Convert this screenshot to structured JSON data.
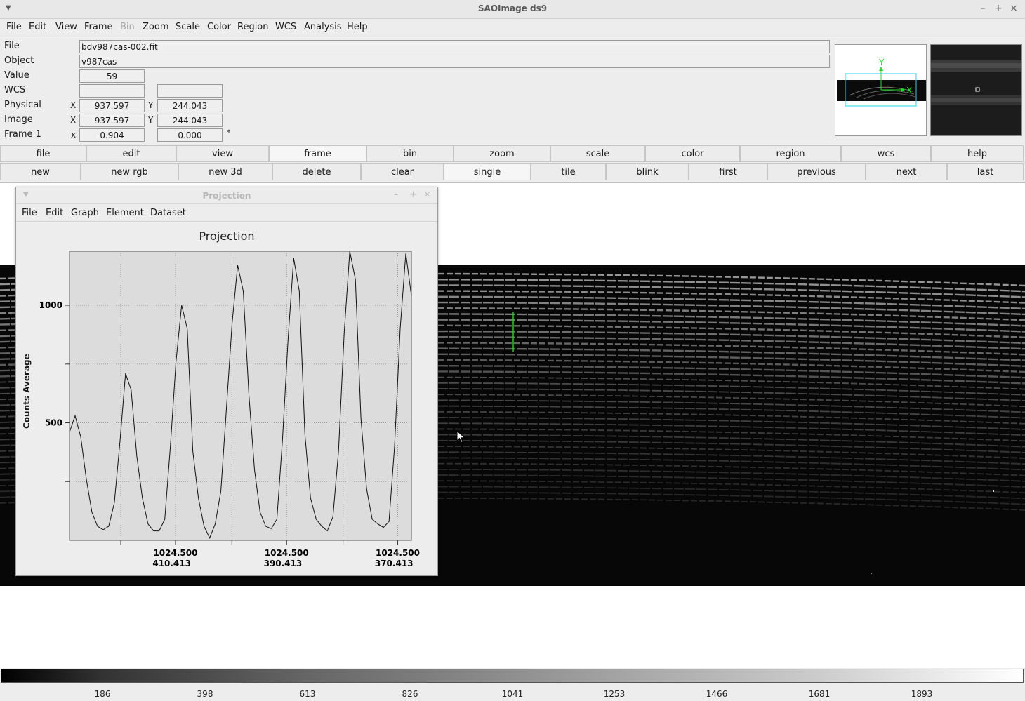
{
  "window": {
    "title": "SAOImage ds9"
  },
  "menubar": [
    "File",
    "Edit",
    "View",
    "Frame",
    "Bin",
    "Zoom",
    "Scale",
    "Color",
    "Region",
    "WCS",
    "Analysis",
    "Help"
  ],
  "menubar_disabled": [
    "Bin"
  ],
  "info": {
    "file_label": "File",
    "file_value": "bdv987cas-002.fit",
    "object_label": "Object",
    "object_value": "v987cas",
    "value_label": "Value",
    "value_value": "59",
    "wcs_label": "WCS",
    "wcs_value1": "",
    "wcs_value2": "",
    "physical_label": "Physical",
    "physical_x_axis": "X",
    "physical_x": "937.597",
    "physical_y_axis": "Y",
    "physical_y": "244.043",
    "image_label": "Image",
    "image_x_axis": "X",
    "image_x": "937.597",
    "image_y_axis": "Y",
    "image_y": "244.043",
    "frame_label": "Frame 1",
    "frame_x_axis": "x",
    "frame_zoom": "0.904",
    "frame_angle": "0.000",
    "frame_angle_unit": "°"
  },
  "panner": {
    "x_label": "X",
    "y_label": "Y"
  },
  "button_row1": [
    "file",
    "edit",
    "view",
    "frame",
    "bin",
    "zoom",
    "scale",
    "color",
    "region",
    "wcs",
    "help"
  ],
  "button_row1_active": "frame",
  "button_row2": [
    "new",
    "new rgb",
    "new 3d",
    "delete",
    "clear",
    "single",
    "tile",
    "blink",
    "first",
    "previous",
    "next",
    "last"
  ],
  "button_row2_active": "single",
  "colorbar": {
    "ticks": [
      "186",
      "398",
      "613",
      "826",
      "1041",
      "1253",
      "1466",
      "1681",
      "1893"
    ]
  },
  "projection": {
    "window_title": "Projection",
    "menu": [
      "File",
      "Edit",
      "Graph",
      "Element",
      "Dataset"
    ],
    "graph_title": "Projection",
    "ylabel": "Counts Average",
    "chart_data": {
      "type": "line",
      "title": "Projection",
      "ylabel": "Counts Average",
      "xlabel": "",
      "ylim": [
        0,
        1230
      ],
      "yticks": [
        500,
        1000
      ],
      "xtick_labels": [
        [
          "1024.500",
          "410.413"
        ],
        [
          "1024.500",
          "390.413"
        ],
        [
          "1024.500",
          "370.413"
        ]
      ],
      "x": [
        0,
        1,
        2,
        3,
        4,
        5,
        6,
        7,
        8,
        9,
        10,
        11,
        12,
        13,
        14,
        15,
        16,
        17,
        18,
        19,
        20,
        21,
        22,
        23,
        24,
        25,
        26,
        27,
        28,
        29,
        30,
        31,
        32,
        33,
        34,
        35,
        36,
        37,
        38,
        39,
        40,
        41,
        42,
        43,
        44,
        45,
        46,
        47,
        48,
        49,
        50,
        51,
        52,
        53,
        54,
        55,
        56,
        57,
        58,
        59,
        60,
        61
      ],
      "values": [
        460,
        530,
        440,
        260,
        120,
        60,
        45,
        60,
        160,
        420,
        710,
        640,
        360,
        180,
        70,
        40,
        40,
        90,
        400,
        760,
        1000,
        900,
        380,
        180,
        60,
        10,
        70,
        210,
        560,
        920,
        1170,
        1060,
        620,
        300,
        120,
        60,
        50,
        90,
        430,
        860,
        1200,
        1060,
        450,
        180,
        90,
        60,
        40,
        100,
        380,
        880,
        1230,
        1110,
        520,
        220,
        90,
        70,
        55,
        80,
        400,
        900,
        1220,
        1040
      ]
    }
  }
}
